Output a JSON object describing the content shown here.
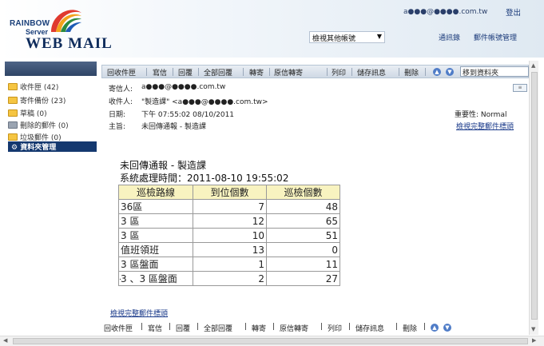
{
  "header": {
    "logo_line1": "RAINBOW",
    "logo_line2": "Server",
    "logo_line3": "WEB MAIL",
    "user_email": "a●●●@●●●●.com.tw",
    "logout": "登出",
    "account_select": "檢視其他帳號",
    "contacts": "通訊錄",
    "settings": "郵件帳號管理"
  },
  "sidebar": {
    "folders": [
      {
        "label": "收件匣",
        "count": "(42)"
      },
      {
        "label": "寄件備份",
        "count": "(23)"
      },
      {
        "label": "草稿",
        "count": "(0)"
      },
      {
        "label": "刪除的郵件",
        "count": "(0)"
      },
      {
        "label": "垃圾郵件",
        "count": "(0)"
      }
    ],
    "manage": "資料夾管理"
  },
  "toolbar": {
    "reply": "回收件匣",
    "compose": "寫信",
    "answer": "回覆",
    "reply_all": "全部回覆",
    "forward": "轉寄",
    "forward_original": "原信轉寄",
    "print": "列印",
    "save": "儲存訊息",
    "delete": "刪除",
    "move_to": "移到資料夾"
  },
  "mail": {
    "from_label": "寄信人:",
    "from_value": "a●●●@●●●●.com.tw",
    "to_label": "收件人:",
    "to_value": "\"製造課\" <a●●●@●●●●.com.tw>",
    "date_label": "日期:",
    "date_value": "下午 07:55:02 08/10/2011",
    "subject_label": "主旨:",
    "subject_value": "未回傳通報 - 製造課",
    "priority": "重要性: Normal",
    "view_full": "檢視完整郵件標頭"
  },
  "body": {
    "title": "未回傳通報 - 製造課",
    "time": "系統處理時間：2011-08-10 19:55:02",
    "table": {
      "headers": [
        "巡檢路線",
        "到位個數",
        "巡檢個數"
      ],
      "rows": [
        [
          "36區",
          "7",
          "48"
        ],
        [
          "3 區",
          "12",
          "65"
        ],
        [
          "3 區",
          "10",
          "51"
        ],
        [
          "值班領班",
          "13",
          "0"
        ],
        [
          "3 區盤面",
          "1",
          "11"
        ],
        [
          "3 、3 區盤面",
          "2",
          "27"
        ]
      ]
    },
    "dot": ".",
    "view_full": "檢視完整郵件標頭"
  },
  "bottom_bar": {
    "items": [
      "回收件匣",
      "寫信",
      "回覆",
      "全部回覆",
      "轉寄",
      "原信轉寄",
      "列印",
      "儲存訊息",
      "刪除"
    ]
  }
}
